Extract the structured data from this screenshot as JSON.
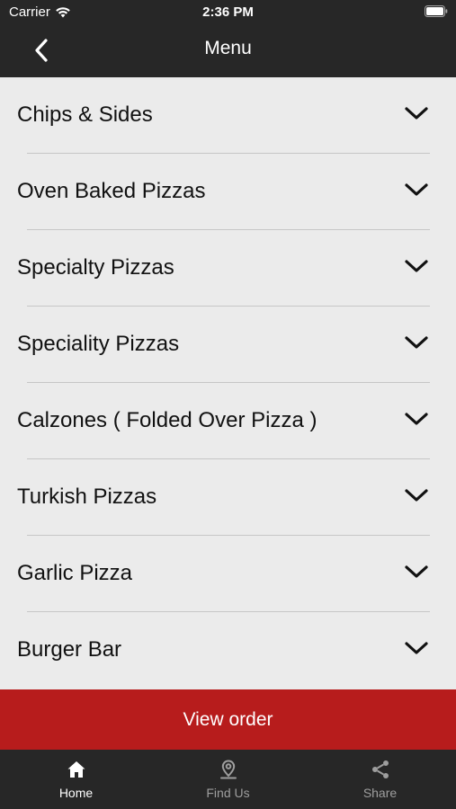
{
  "status_bar": {
    "carrier": "Carrier",
    "time": "2:36 PM"
  },
  "nav": {
    "title": "Menu",
    "back_icon": "chevron-left-icon"
  },
  "menu": {
    "items": [
      {
        "label": "Chips & Sides"
      },
      {
        "label": "Oven Baked Pizzas"
      },
      {
        "label": "Specialty Pizzas"
      },
      {
        "label": "Speciality Pizzas"
      },
      {
        "label": "Calzones ( Folded Over Pizza )"
      },
      {
        "label": "Turkish Pizzas"
      },
      {
        "label": "Garlic Pizza"
      },
      {
        "label": "Burger Bar"
      }
    ]
  },
  "view_order": {
    "label": "View order",
    "color": "#b71c1c"
  },
  "tabs": [
    {
      "label": "Home",
      "icon": "home-icon",
      "active": true
    },
    {
      "label": "Find Us",
      "icon": "location-pin-icon",
      "active": false
    },
    {
      "label": "Share",
      "icon": "share-icon",
      "active": false
    }
  ],
  "colors": {
    "bar_background": "#272727",
    "list_background": "#ebebeb",
    "accent": "#b71c1c"
  }
}
